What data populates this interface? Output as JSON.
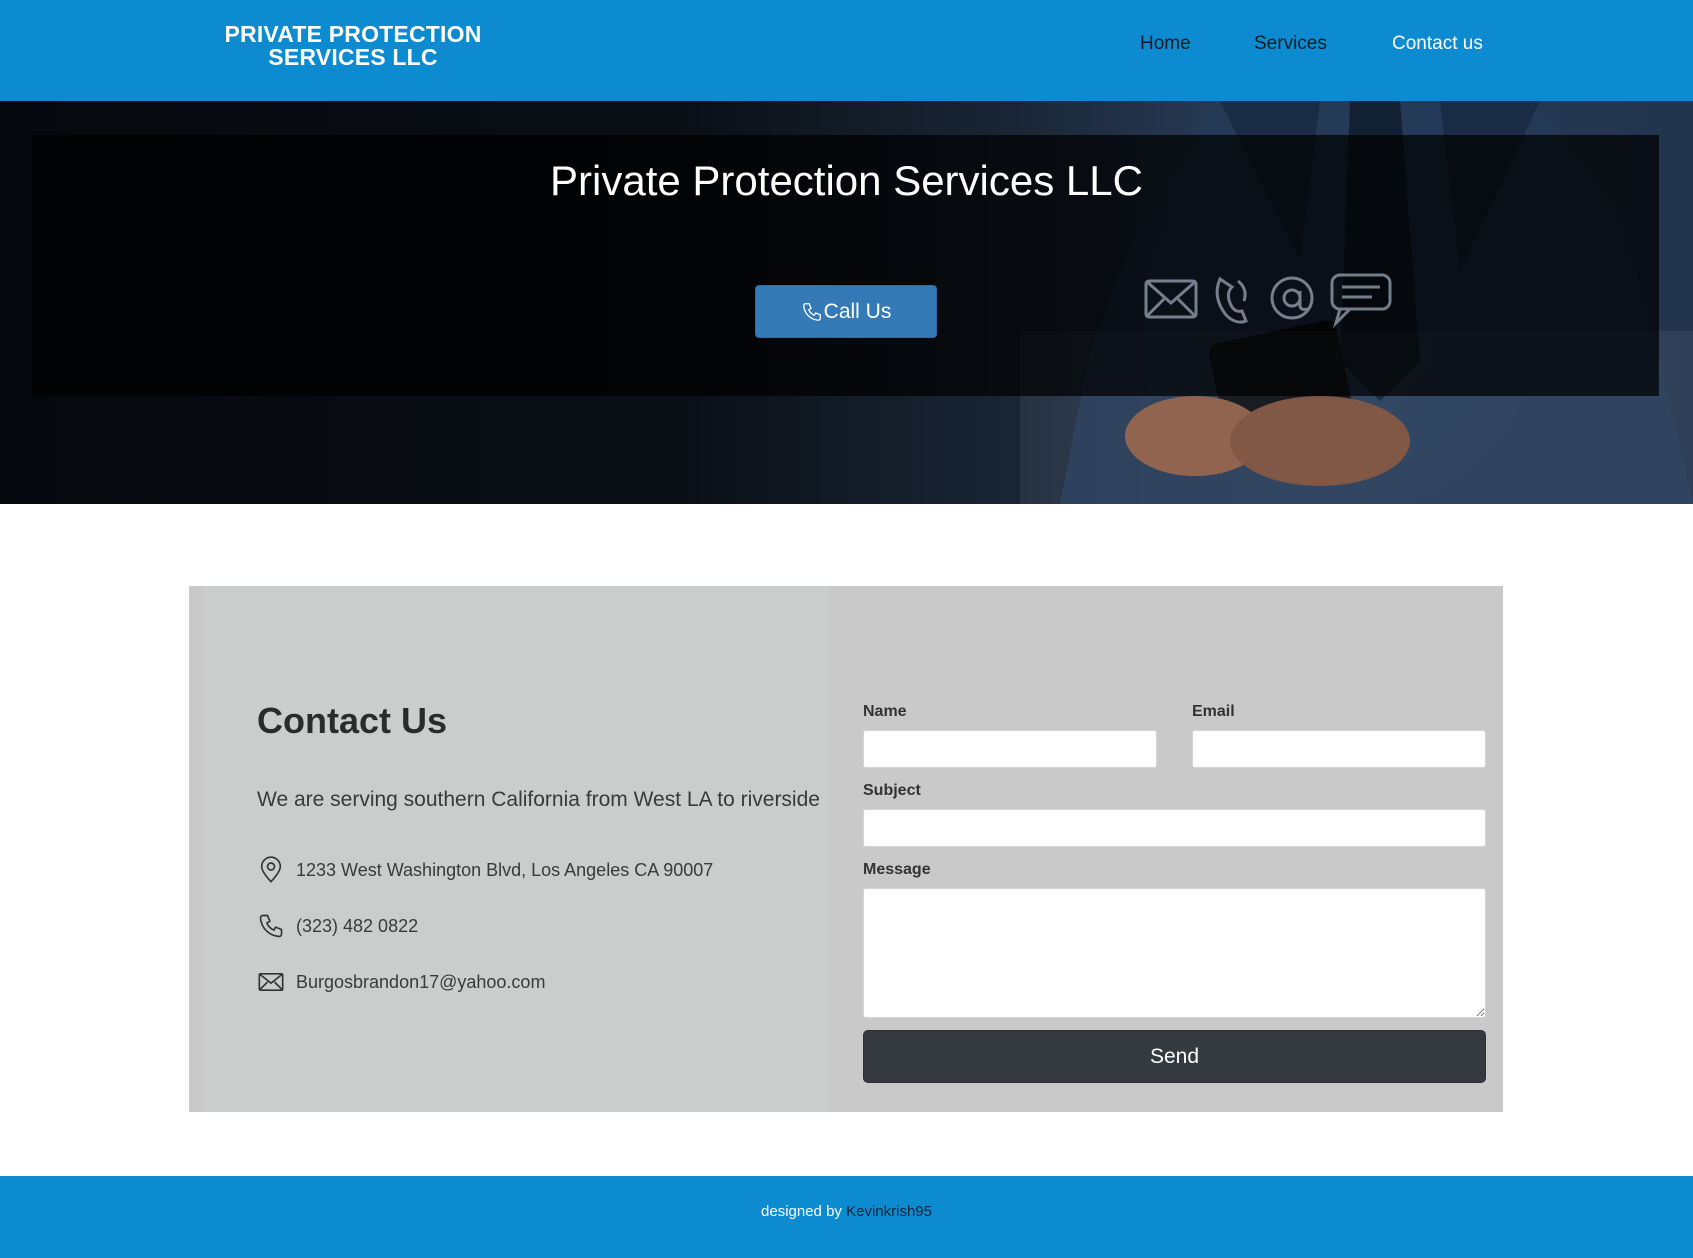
{
  "navbar": {
    "brand_line1": "PRIVATE PROTECTION",
    "brand_line2": "SERVICES LLC",
    "links": [
      "Home",
      "Services",
      "Contact us"
    ],
    "active": "Contact us"
  },
  "hero": {
    "title": "Private Protection Services LLC",
    "call_button_label": "Call Us",
    "call_icon": "phone-icon"
  },
  "contact": {
    "heading": "Contact Us",
    "tagline": "We are serving southern California from West LA to riverside",
    "address": "1233 West Washington Blvd, Los Angeles CA 90007",
    "phone": "(323) 482 0822",
    "email": "Burgosbrandon17@yahoo.com",
    "icons": [
      "map-pin-icon",
      "phone-icon",
      "envelope-icon"
    ]
  },
  "form": {
    "name_label": "Name",
    "name_value": "",
    "email_label": "Email",
    "email_value": "",
    "subject_label": "Subject",
    "subject_value": "",
    "message_label": "Message",
    "message_value": "",
    "send_label": "Send"
  },
  "footer": {
    "prefix": "designed by ",
    "author": "Kevinkrish95"
  },
  "colors": {
    "primary_blue": "#0d8bd1",
    "button_blue": "#337ab7",
    "send_dark": "#343a40",
    "panel_grey": "#c9c9c9"
  }
}
